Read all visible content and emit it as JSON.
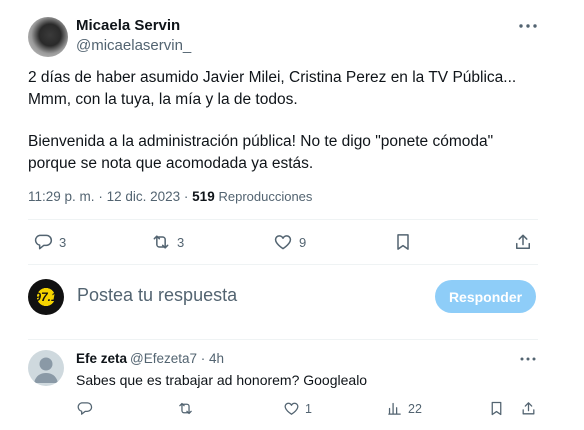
{
  "tweet": {
    "author_name": "Micaela Servin",
    "author_handle": "@micaelaservin_",
    "lines": [
      "2 días de haber asumido Javier Milei, Cristina Perez en la TV Pública...",
      "Mmm, con la tuya, la mía y la de todos.",
      "Bienvenida a la administración pública! No te digo \"ponete cómoda\"",
      "porque se nota que acomodada ya estás."
    ],
    "time": "11:29 p. m.",
    "date": "12 dic. 2023",
    "separator": "·",
    "views_count": "519",
    "views_label": "Reproducciones",
    "actions": {
      "reply_count": "3",
      "retweet_count": "3",
      "like_count": "9"
    }
  },
  "composer": {
    "placeholder": "Postea tu respuesta",
    "avatar_text": "97.1",
    "reply_button": "Responder"
  },
  "comment": {
    "author_name": "Efe zeta",
    "author_handle": "@Efezeta7",
    "age": "4h",
    "text": "Sabes que es trabajar ad honorem? Googlealo",
    "actions": {
      "like_count": "1",
      "views_count": "22"
    }
  },
  "colors": {
    "text_primary": "#0f1419",
    "text_secondary": "#536471",
    "reply_button_disabled": "#8ecdf8",
    "divider": "#eff3f4"
  }
}
